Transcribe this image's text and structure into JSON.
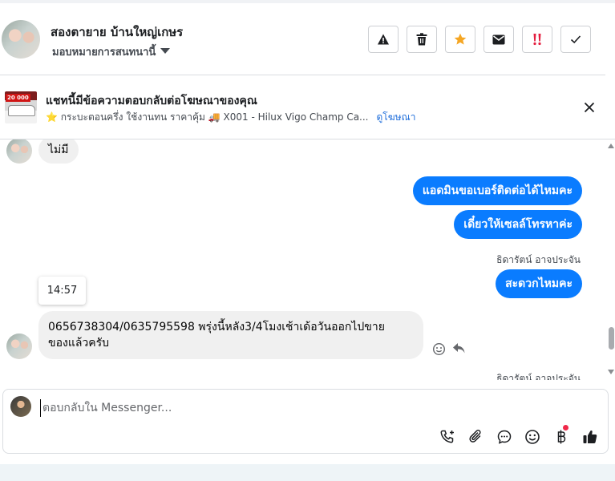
{
  "header": {
    "contact_name": "สองตายาย บ้านใหญ่เกษร",
    "assign_label": "มอบหมายการสนทนานี้",
    "actions": [
      {
        "name": "report-button",
        "icon": "warning-triangle-icon"
      },
      {
        "name": "delete-button",
        "icon": "trash-icon"
      },
      {
        "name": "star-button",
        "icon": "star-icon"
      },
      {
        "name": "mark-unread-button",
        "icon": "envelope-icon"
      },
      {
        "name": "follow-up-button",
        "icon": "double-exclamation-icon"
      },
      {
        "name": "mark-done-button",
        "icon": "checkmark-icon"
      }
    ]
  },
  "ad_banner": {
    "thumb_price": "20 000",
    "title": "แชทนี้มีข้อความตอบกลับต่อโฆษณาของคุณ",
    "subtitle": "⭐ กระบะตอนครึ่ง ใช้งานทน ราคาคุ้ม 🚚 X001 - Hilux Vigo Champ Ca...",
    "link": "ดูโฆษณา"
  },
  "messages": {
    "m1": "ไม่มี",
    "m2": "แอดมินขอเบอร์ติดต่อได้ไหมคะ",
    "m3": "เดี๋ยวให้เซลล์โทรหาค่ะ",
    "sender1": "ธิดารัตน์ อาจประจัน",
    "m4": "สะดวกไหมคะ",
    "tooltip_time": "14:57",
    "m5_line1": "0656738304/0635795598 พรุ่งนี้หลัง3/4โมงเช้าเด้อวันออกไปขาย",
    "m5_line2": "ของแล้วครับ",
    "sender2": "ธิดารัตน์ อาจประจัน"
  },
  "composer": {
    "value": "",
    "placeholder": "ตอบกลับใน Messenger..."
  },
  "colors": {
    "outgoing_bubble": "#0a7cff",
    "incoming_bubble": "#f0f0f0",
    "link": "#216fdb",
    "star": "#f5a623",
    "follow_up": "#e41e3f",
    "notification_dot": "#f02849"
  }
}
